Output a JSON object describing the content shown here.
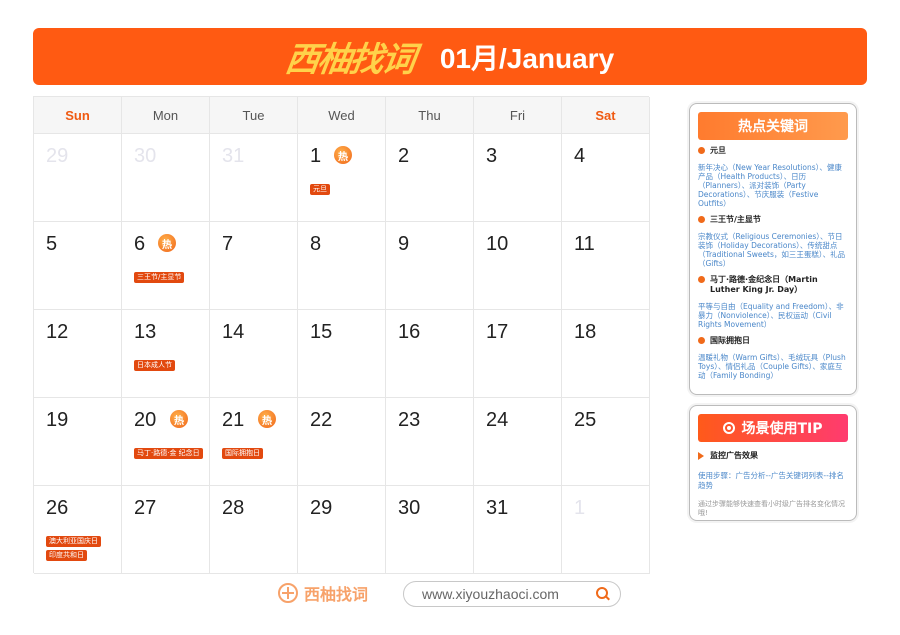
{
  "header": {
    "logo_text": "西柚找词",
    "title": "01月/January",
    "accent_color": "#ff5a12"
  },
  "weekdays": [
    "Sun",
    "Mon",
    "Tue",
    "Wed",
    "Thu",
    "Fri",
    "Sat"
  ],
  "days": [
    {
      "num": "29",
      "muted": true
    },
    {
      "num": "30",
      "muted": true
    },
    {
      "num": "31",
      "muted": true
    },
    {
      "num": "1",
      "hot": true,
      "tags": [
        "元旦"
      ]
    },
    {
      "num": "2"
    },
    {
      "num": "3"
    },
    {
      "num": "4"
    },
    {
      "num": "5"
    },
    {
      "num": "6",
      "hot": true,
      "tags": [
        "三王节/主显节"
      ]
    },
    {
      "num": "7"
    },
    {
      "num": "8"
    },
    {
      "num": "9"
    },
    {
      "num": "10"
    },
    {
      "num": "11"
    },
    {
      "num": "12"
    },
    {
      "num": "13",
      "tags": [
        "日本成人节"
      ]
    },
    {
      "num": "14"
    },
    {
      "num": "15"
    },
    {
      "num": "16"
    },
    {
      "num": "17"
    },
    {
      "num": "18"
    },
    {
      "num": "19"
    },
    {
      "num": "20",
      "hot": true,
      "tags": [
        "马丁·路德·金 纪念日"
      ]
    },
    {
      "num": "21",
      "hot": true,
      "tags": [
        "国际拥抱日"
      ]
    },
    {
      "num": "22"
    },
    {
      "num": "23"
    },
    {
      "num": "24"
    },
    {
      "num": "25"
    },
    {
      "num": "26",
      "tags": [
        "澳大利亚国庆日",
        "印度共和日"
      ]
    },
    {
      "num": "27"
    },
    {
      "num": "28"
    },
    {
      "num": "29"
    },
    {
      "num": "30"
    },
    {
      "num": "31"
    },
    {
      "num": "1",
      "muted": true
    }
  ],
  "hot_label": "热",
  "keywords_panel": {
    "title": "热点关键词",
    "items": [
      {
        "title": "元旦",
        "desc": "新年决心（New Year Resolutions）、健康产品（Health Products）、日历（Planners）、派对装饰（Party Decorations）、节庆服装（Festive Outfits）"
      },
      {
        "title": "三王节/主显节",
        "desc": "宗教仪式（Religious Ceremonies）、节日装饰（Holiday Decorations）、传统甜点（Traditional Sweets，如三王蛋糕）、礼品（Gifts）"
      },
      {
        "title": "马丁·路德·金纪念日（Martin Luther King Jr. Day）",
        "desc": "平等与自由（Equality and Freedom）、非暴力（Nonviolence）、民权运动（Civil Rights Movement）"
      },
      {
        "title": "国际拥抱日",
        "desc": "温暖礼物（Warm Gifts）、毛绒玩具（Plush Toys）、情侣礼品（Couple Gifts）、家庭互动（Family Bonding）"
      }
    ]
  },
  "tips_panel": {
    "title": "场景使用TIP",
    "item_title": "监控广告效果",
    "path": "使用步骤：广告分析--广告关键词列表--排名趋势",
    "note": "通过步骤能够快速查看小时级广告排名变化情况哦!"
  },
  "footer": {
    "brand": "西柚找词",
    "url": "www.xiyouzhaoci.com"
  }
}
